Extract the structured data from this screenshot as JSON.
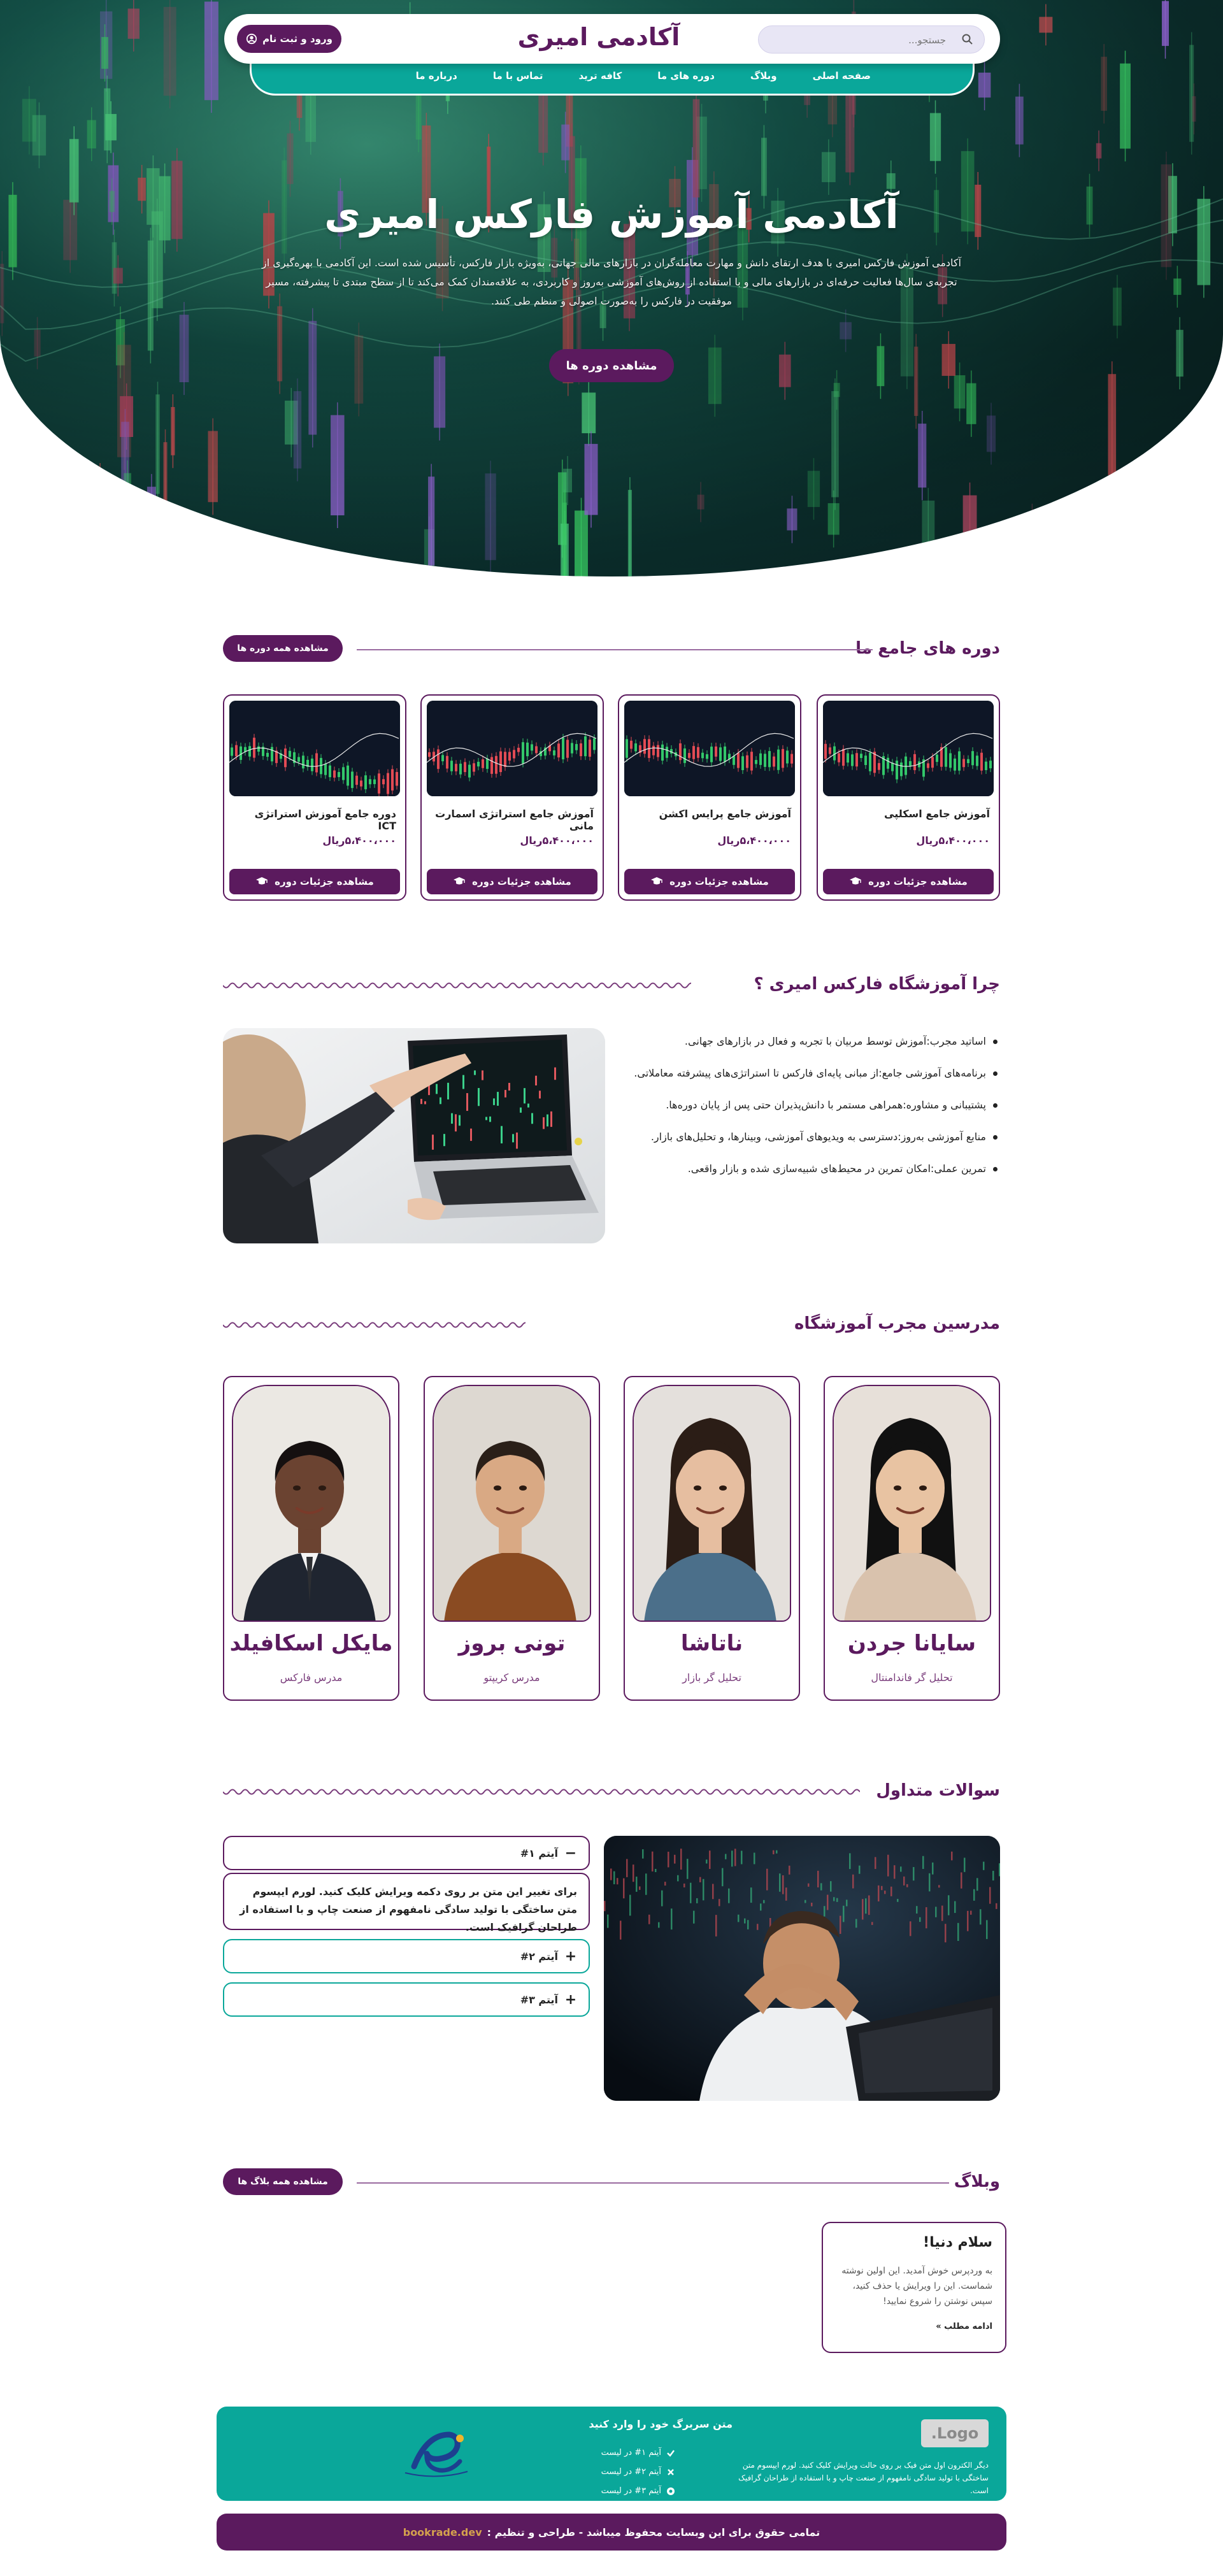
{
  "header": {
    "site_title": "آکادمی امیری",
    "search_placeholder": "جستجو...",
    "search_icon": "search-icon",
    "login_label": "ورود و ثبت نام",
    "login_icon": "user-circle-icon"
  },
  "nav": {
    "items": [
      "صفحه اصلی",
      "وبلاگ",
      "دوره های ما",
      "کافه ترید",
      "تماس با ما",
      "درباره ما"
    ]
  },
  "hero": {
    "title": "آکادمی آموزش فارکس امیری",
    "description": "آکادمی آموزش فارکس امیری با هدف ارتقای دانش و مهارت معامله‌گران در بازارهای مالی جهانی، به‌ویژه بازار فارکس، تأسیس شده است. این آکادمی با بهره‌گیری از تجربه‌ی سال‌ها فعالیت حرفه‌ای در بازارهای مالی و با استفاده از روش‌های آموزشی به‌روز و کاربردی، به علاقه‌مندان کمک می‌کند تا از سطح مبتدی تا پیشرفته، مسیر موفقیت در فارکس را به‌صورت اصولی و منظم طی کنند.",
    "cta_label": "مشاهده دوره ها"
  },
  "courses": {
    "title": "دوره های جامع ما",
    "view_all_label": "مشاهده همه دوره ها",
    "button_icon": "graduation-cap-icon",
    "items": [
      {
        "name": "آموزش جامع اسکلپی",
        "price": "۵،۴۰۰،۰۰۰ریال",
        "button": "مشاهده جزئیات دوره"
      },
      {
        "name": "آموزش جامع پرایس اکشن",
        "price": "۵،۴۰۰،۰۰۰ریال",
        "button": "مشاهده جزئیات دوره"
      },
      {
        "name": "آموزش جامع استراتژی اسمارت مانی",
        "price": "۵،۴۰۰،۰۰۰ریال",
        "button": "مشاهده جزئیات دوره"
      },
      {
        "name": "دوره جامع آموزش استراتژی ICT",
        "price": "۵،۴۰۰،۰۰۰ریال",
        "button": "مشاهده جزئیات دوره"
      }
    ]
  },
  "why": {
    "title": "چرا آموزشگاه فارکس امیری ؟",
    "items": [
      "اساتید مجرب:آموزش توسط مربیان با تجربه و فعال در بازارهای جهانی.",
      "برنامه‌های آموزشی جامع:از مبانی پایه‌ای فارکس تا استراتژی‌های پیشرفته معاملاتی.",
      "پشتیبانی و مشاوره:همراهی مستمر با دانش‌پذیران حتی پس از پایان دوره‌ها.",
      "منابع آموزشی به‌روز:دسترسی به ویدیوهای آموزشی، وبینارها، و تحلیل‌های بازار.",
      "تمرین عملی:امکان تمرین در محیط‌های شبیه‌سازی شده و بازار واقعی."
    ]
  },
  "teachers": {
    "title": "مدرسین مجرب آموزشگاه",
    "items": [
      {
        "name": "سایانا جردن",
        "role": "تحلیل گر فاندامنتال"
      },
      {
        "name": "ناتاشا",
        "role": "تحلیل گر بازار"
      },
      {
        "name": "تونی بروز",
        "role": "مدرس کریپتو"
      },
      {
        "name": "مایکل اسکافیلد",
        "role": "مدرس فارکس"
      }
    ]
  },
  "faq": {
    "title": "سوالات متداول",
    "items": [
      {
        "question": "آیتم ۱#",
        "icon": "minus-icon",
        "open": true
      },
      {
        "question": "آیتم ۲#",
        "icon": "plus-icon",
        "open": false
      },
      {
        "question": "آیتم ۳#",
        "icon": "plus-icon",
        "open": false
      }
    ],
    "answer": "برای تغییر این متن بر روی دکمه ویرایش کلیک کنید. لورم ایپسوم متن ساختگی با تولید سادگی نامفهوم از صنعت چاپ و با استفاده از طراحان گرافیک است."
  },
  "blog": {
    "title": "وبلاگ",
    "view_all_label": "مشاهده همه بلاگ ها",
    "posts": [
      {
        "title": "سلام دنیا!",
        "excerpt": "به وردپرس خوش آمدید. این اولین نوشته شماست. این را ویرایش یا حذف کنید، سپس نوشتن را شروع نمایید!",
        "more": "ادامه مطلب »"
      }
    ]
  },
  "footer": {
    "logo_text": "Logo.",
    "about": "دیگر الکترون اول متن فیک بر روی حالت ویرایش کلیک کنید. لورم ایپسوم متن ساختگی با تولید سادگی نامفهوم از صنعت چاپ و با استفاده از طراحان گرافیک است.",
    "links_title": "متن سربرگ خود را وارد کنید",
    "links": [
      {
        "label": "آیتم ۱# در لیست",
        "icon": "check-icon"
      },
      {
        "label": "آیتم ۲# در لیست",
        "icon": "close-icon"
      },
      {
        "label": "آیتم ۳# در لیست",
        "icon": "circle-dot-icon"
      }
    ]
  },
  "copyright": {
    "text": "تمامی حقوق برای این وبسایت محفوظ میباشد - طراحی و تنظیم :",
    "brand": "bookrade.dev"
  },
  "colors": {
    "purple": "#5b1a5e",
    "teal": "#0aa79a",
    "price": "#5b1a5e"
  }
}
